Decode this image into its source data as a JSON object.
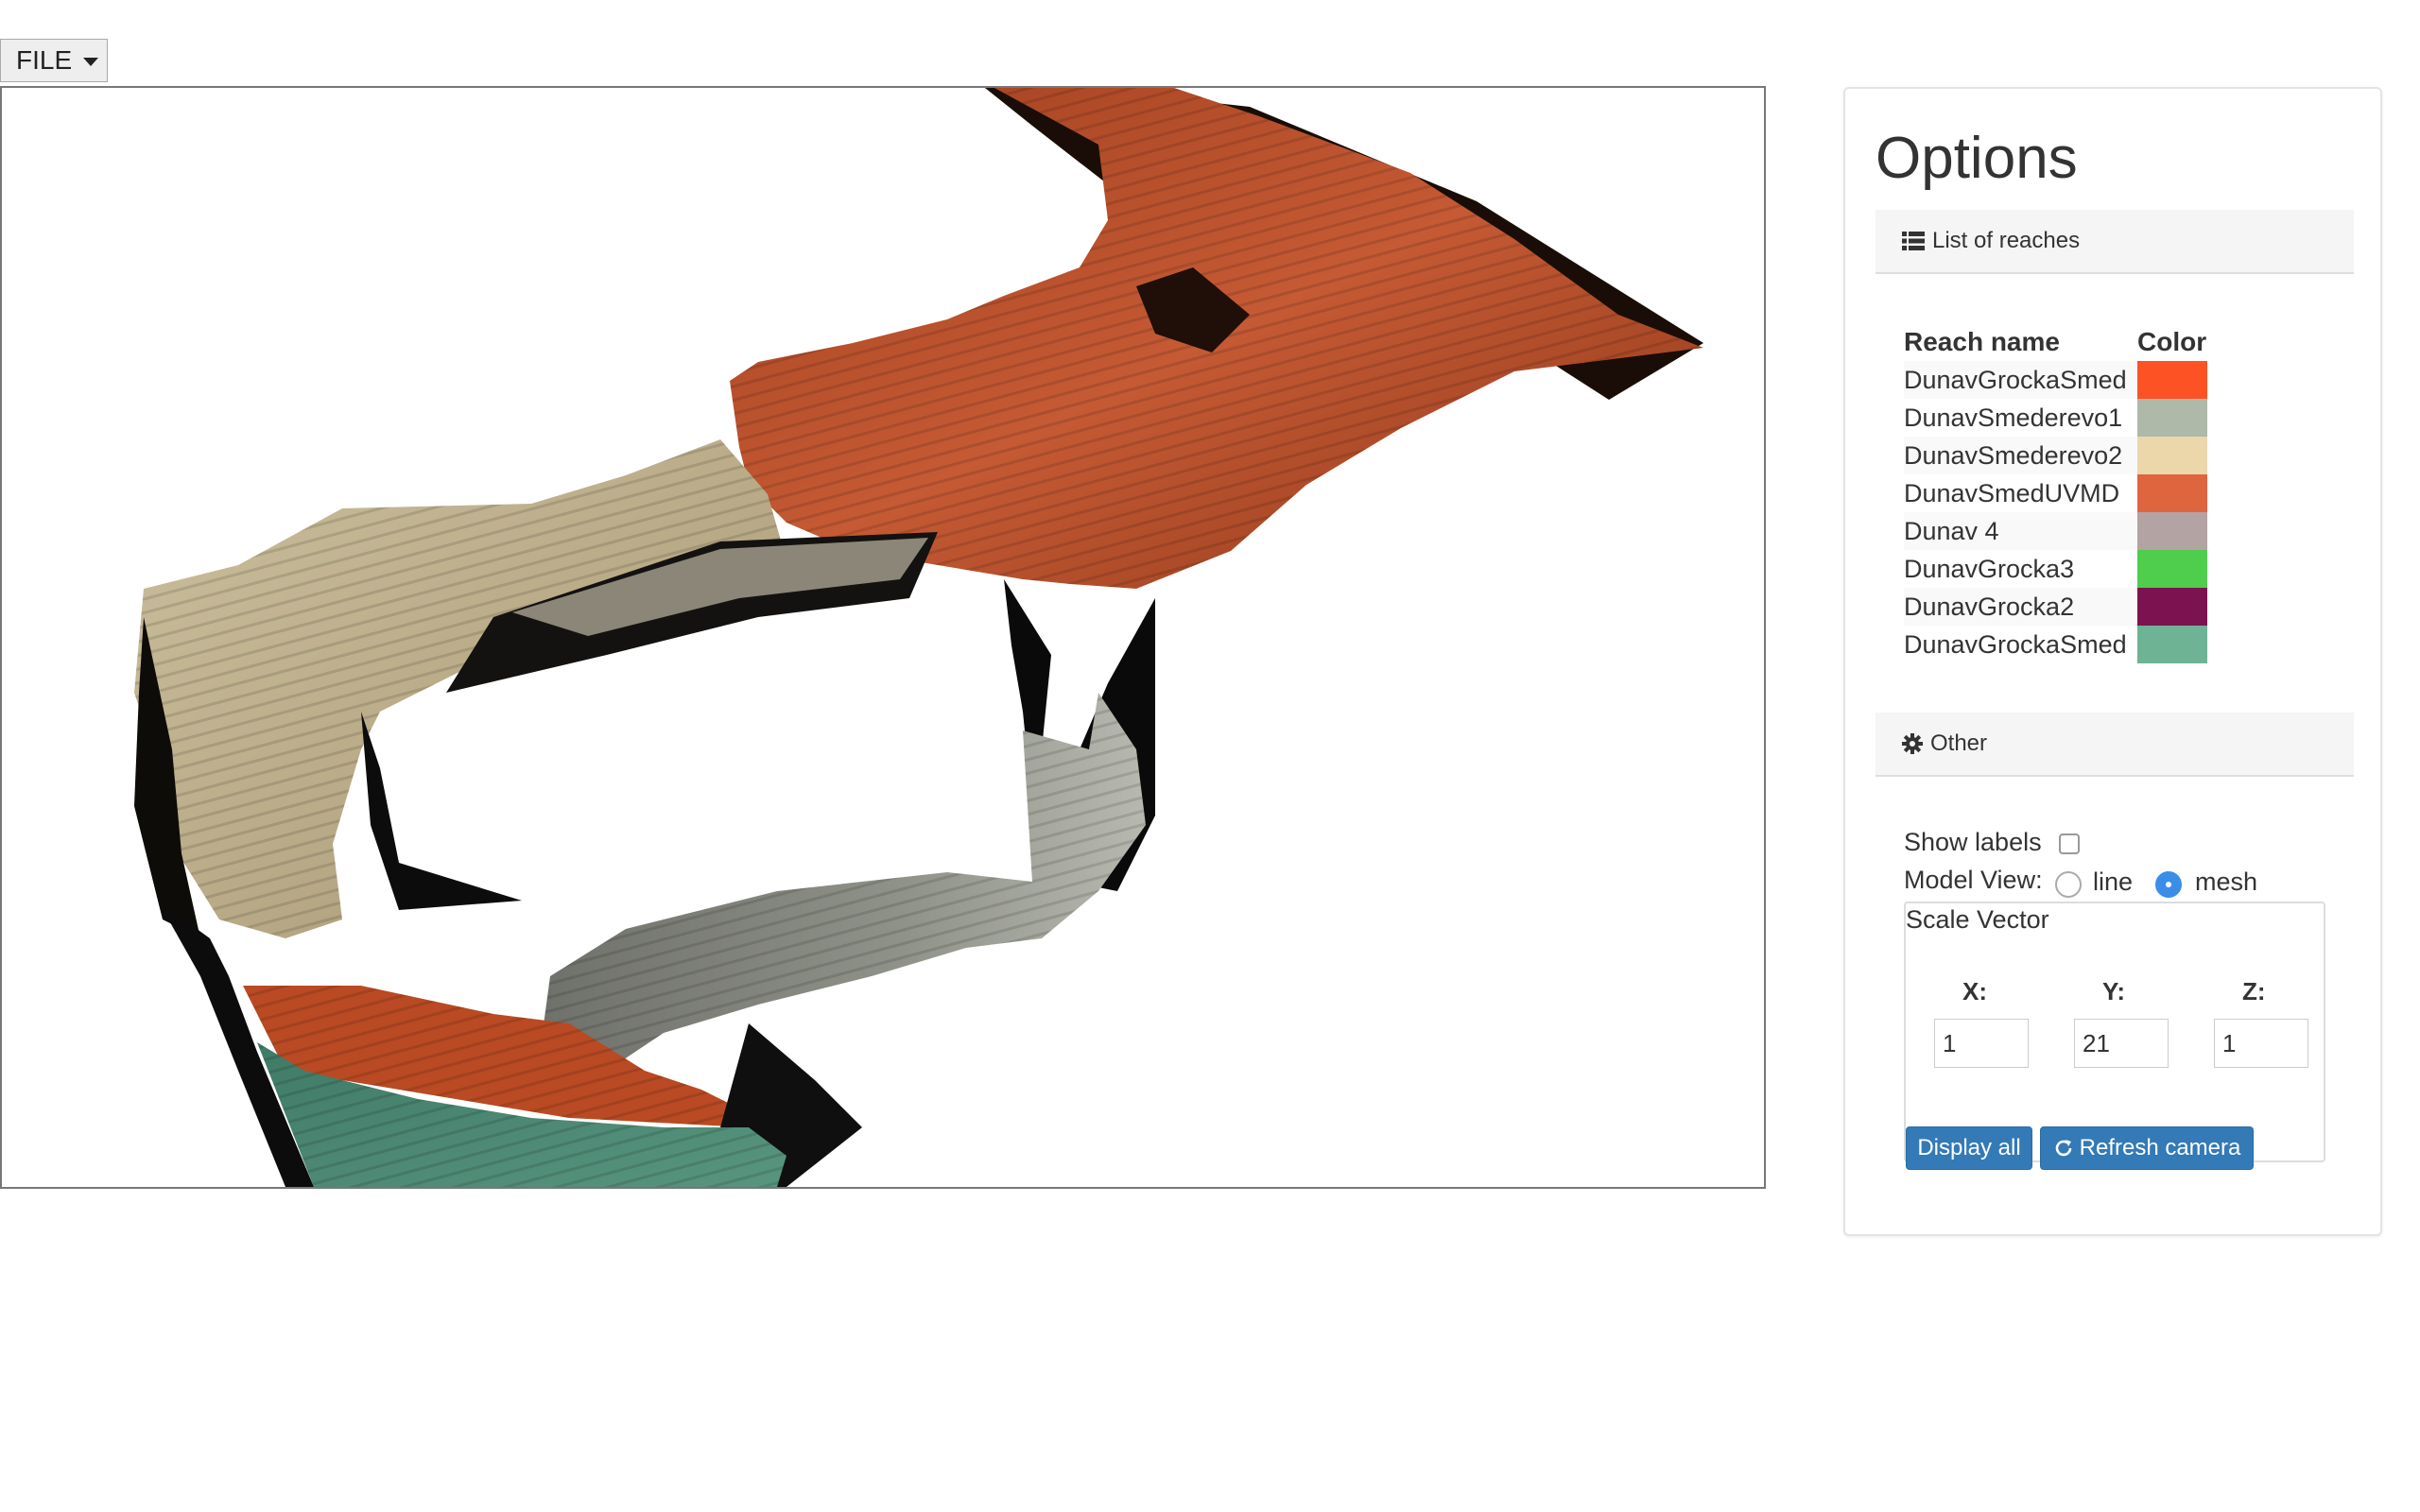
{
  "menu": {
    "file_label": "FILE"
  },
  "options": {
    "title": "Options",
    "reaches_section": {
      "title": "List of reaches",
      "icon": "list-icon",
      "columns": [
        "Reach name",
        "Color"
      ],
      "rows": [
        {
          "name": "DunavGrockaSmed",
          "color": "#fd5224"
        },
        {
          "name": "DunavSmederevo1",
          "color": "#aeb9a9"
        },
        {
          "name": "DunavSmederevo2",
          "color": "#ecd7ab"
        },
        {
          "name": "DunavSmedUVMD",
          "color": "#df653f"
        },
        {
          "name": "Dunav 4",
          "color": "#b3a3a2"
        },
        {
          "name": "DunavGrocka3",
          "color": "#4fcd4c"
        },
        {
          "name": "DunavGrocka2",
          "color": "#7d1250"
        },
        {
          "name": "DunavGrockaSmed",
          "color": "#6db394"
        }
      ]
    },
    "other_section": {
      "title": "Other",
      "icon": "gear-icon",
      "show_labels": "Show labels",
      "show_labels_checked": false,
      "model_view_label": "Model View:",
      "model_view_options": [
        "line",
        "mesh"
      ],
      "model_view_selected": "mesh",
      "scale_vector": {
        "legend": "Scale Vector",
        "x_label": "X:",
        "y_label": "Y:",
        "z_label": "Z:",
        "x_value": "1",
        "y_value": "21",
        "z_value": "1"
      },
      "buttons": {
        "display_all": "Display all",
        "refresh_camera": "Refresh camera"
      }
    }
  },
  "colors": {
    "accent": "#337ab7",
    "radio_selected": "#3b8ee8"
  }
}
